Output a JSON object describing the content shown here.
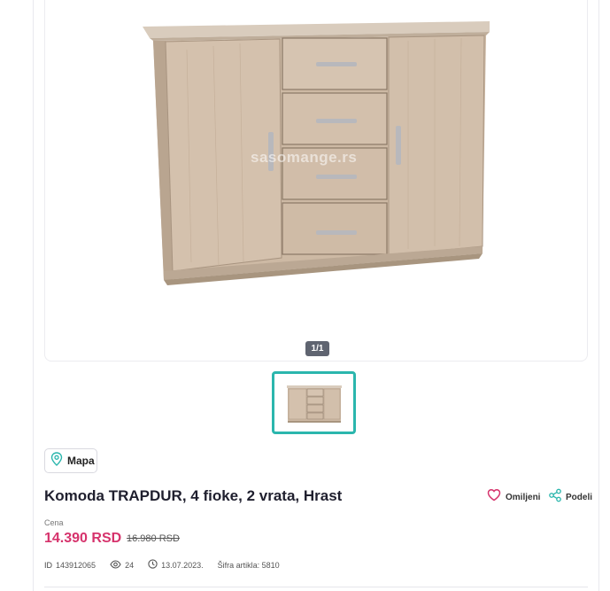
{
  "gallery": {
    "watermark": "sasomange.rs",
    "pager": "1/1"
  },
  "map": {
    "label": "Mapa"
  },
  "listing": {
    "title": "Komoda TRAPDUR, 4 fioke, 2 vrata, Hrast",
    "price_label": "Cena",
    "price": "14.390 RSD",
    "old_price": "16.980 RSD"
  },
  "actions": {
    "favorite_label": "Omiljeni",
    "share_label": "Podeli"
  },
  "meta": {
    "id_label": "ID",
    "id_value": "143912065",
    "views": "24",
    "date": "13.07.2023.",
    "sku": "Šifra artikla: 5810"
  },
  "colors": {
    "price": "#d6336c",
    "thumb_border": "#2bb6ad",
    "favorite_icon": "#d6336c",
    "share_icon": "#2bb6ad",
    "wood": "#cdb9a4"
  }
}
